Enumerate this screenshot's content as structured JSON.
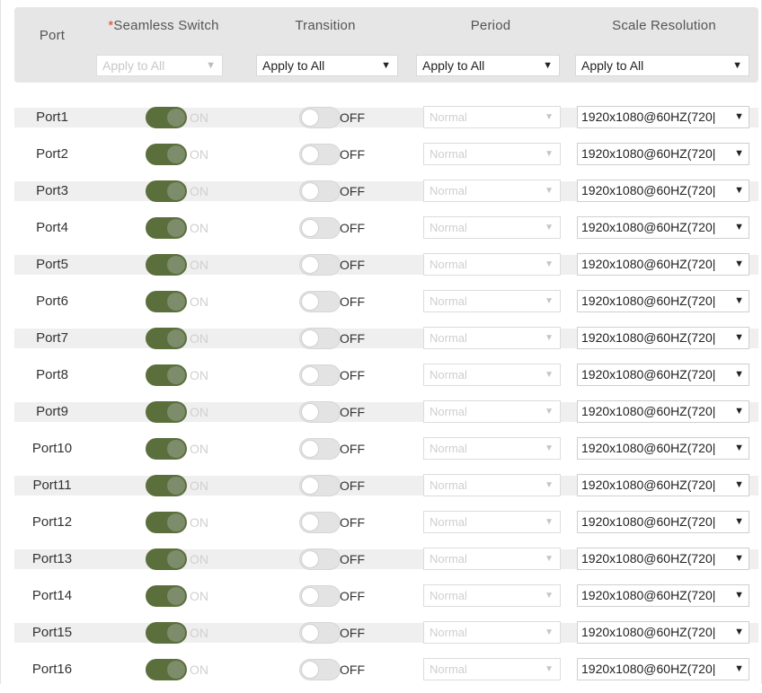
{
  "header": {
    "port": "Port",
    "seamless_req": "*",
    "seamless": "Seamless Switch",
    "transition": "Transition",
    "period": "Period",
    "scale": "Scale Resolution",
    "seamless_all": "Apply to All",
    "transition_all": "Apply to All",
    "period_all": "Apply to All",
    "scale_all": "Apply to All"
  },
  "labels": {
    "on": "ON",
    "off": "OFF"
  },
  "period_value": "Normal",
  "resolution_value": "1920x1080@60HZ(720|",
  "colors": {
    "toggle_on": "#5a6f3b",
    "header_bg": "#e6e6e6",
    "row_alt": "#efefef"
  },
  "icons": {
    "dropdown": "chevron-down-icon"
  },
  "rows": [
    {
      "port": "Port1",
      "seamless": true,
      "transition": false
    },
    {
      "port": "Port2",
      "seamless": true,
      "transition": false
    },
    {
      "port": "Port3",
      "seamless": true,
      "transition": false
    },
    {
      "port": "Port4",
      "seamless": true,
      "transition": false
    },
    {
      "port": "Port5",
      "seamless": true,
      "transition": false
    },
    {
      "port": "Port6",
      "seamless": true,
      "transition": false
    },
    {
      "port": "Port7",
      "seamless": true,
      "transition": false
    },
    {
      "port": "Port8",
      "seamless": true,
      "transition": false
    },
    {
      "port": "Port9",
      "seamless": true,
      "transition": false
    },
    {
      "port": "Port10",
      "seamless": true,
      "transition": false
    },
    {
      "port": "Port11",
      "seamless": true,
      "transition": false
    },
    {
      "port": "Port12",
      "seamless": true,
      "transition": false
    },
    {
      "port": "Port13",
      "seamless": true,
      "transition": false
    },
    {
      "port": "Port14",
      "seamless": true,
      "transition": false
    },
    {
      "port": "Port15",
      "seamless": true,
      "transition": false
    },
    {
      "port": "Port16",
      "seamless": true,
      "transition": false
    }
  ]
}
